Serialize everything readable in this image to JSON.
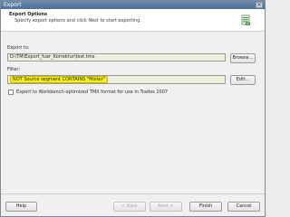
{
  "window": {
    "title": "Export"
  },
  "header": {
    "heading": "Export Options",
    "subtitle": "Specify export options and click Next to start exporting.",
    "icon": "export-spreadsheet-icon"
  },
  "export_to": {
    "label": "Export to:",
    "value": "D:\\TM\\Export_fuer_Korrektur\\test.tmx",
    "browse_label": "Browse..."
  },
  "filter": {
    "label": "Filter:",
    "value": "NOT Source segment CONTAINS \"Mister\"",
    "edit_label": "Edit..."
  },
  "option": {
    "checkbox_label": "Export to Workbench-optimized TMX format for use in Trados 2007",
    "checked": false
  },
  "footer": {
    "help_label": "Help",
    "back_label": "< Back",
    "next_label": "Next >",
    "finish_label": "Finish",
    "cancel_label": "Cancel"
  },
  "colors": {
    "highlight": "#f7f21a",
    "field_background": "#eef0df",
    "titlebar": "#5a7ca4"
  }
}
